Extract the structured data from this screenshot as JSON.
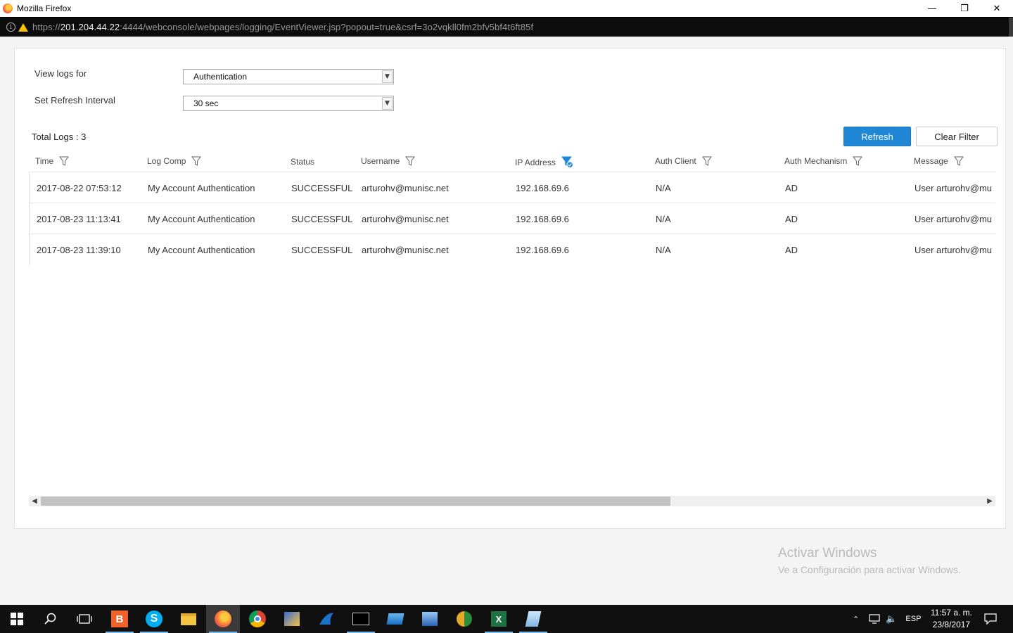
{
  "window": {
    "title": "Mozilla Firefox",
    "controls": {
      "minimize": "—",
      "restore": "❐",
      "close": "✕"
    }
  },
  "urlbar": {
    "scheme": "https://",
    "host": "201.204.44.22",
    "rest": ":4444/webconsole/webpages/logging/EventViewer.jsp?popout=true&csrf=3o2vqkll0fm2bfv5bf4t6ft85f"
  },
  "form": {
    "view_logs_label": "View logs for",
    "view_logs_value": "Authentication",
    "refresh_interval_label": "Set Refresh Interval",
    "refresh_interval_value": "30 sec"
  },
  "toolbar": {
    "total_logs": "Total Logs : 3",
    "refresh_label": "Refresh",
    "clear_filter_label": "Clear Filter"
  },
  "table": {
    "columns": [
      "Time",
      "Log Comp",
      "Status",
      "Username",
      "IP Address",
      "Auth Client",
      "Auth Mechanism",
      "Message"
    ],
    "active_filter_column": "IP Address",
    "rows": [
      [
        "2017-08-22 07:53:12",
        "My Account Authentication",
        "SUCCESSFUL",
        "arturohv@munisc.net",
        "192.168.69.6",
        "N/A",
        "AD",
        "User arturohv@mu"
      ],
      [
        "2017-08-23 11:13:41",
        "My Account Authentication",
        "SUCCESSFUL",
        "arturohv@munisc.net",
        "192.168.69.6",
        "N/A",
        "AD",
        "User arturohv@mu"
      ],
      [
        "2017-08-23 11:39:10",
        "My Account Authentication",
        "SUCCESSFUL",
        "arturohv@munisc.net",
        "192.168.69.6",
        "N/A",
        "AD",
        "User arturohv@mu"
      ]
    ]
  },
  "watermark": {
    "line1": "Activar Windows",
    "line2": "Ve a Configuración para activar Windows."
  },
  "taskbar": {
    "language": "ESP",
    "time": "11:57 a. m.",
    "date": "23/8/2017",
    "apps": [
      "start-icon",
      "search-icon",
      "task-view-icon",
      "brave-icon",
      "skype-icon",
      "file-explorer-icon",
      "firefox-icon",
      "chrome-icon",
      "network-app-icon",
      "shark-app-icon",
      "terminal-icon",
      "remote-desktop-icon",
      "computer-app-icon",
      "media-app-icon",
      "excel-icon",
      "notepad-icon"
    ]
  },
  "colors": {
    "accent": "#1f87d6",
    "urlbar_bg": "#0c0c0d",
    "taskbar_bg": "#101010"
  }
}
